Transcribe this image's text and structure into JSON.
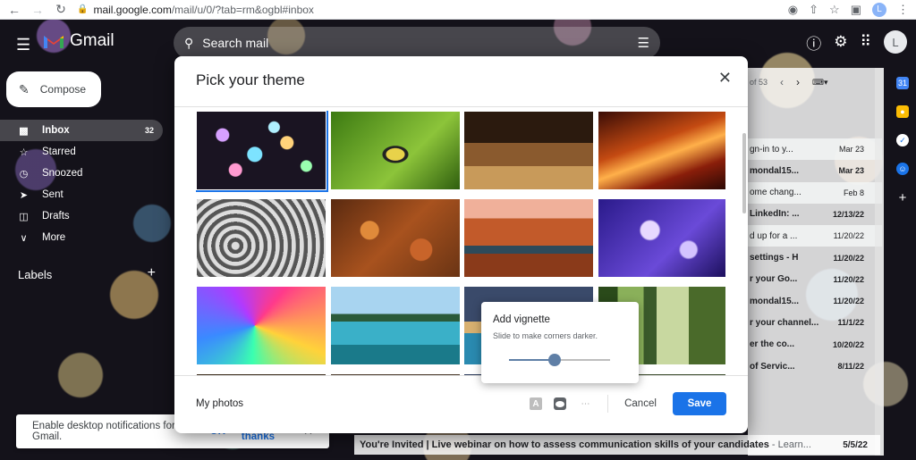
{
  "browser": {
    "url_host": "mail.google.com",
    "url_path": "/mail/u/0/?tab=rm&ogbl#inbox",
    "profile_initial": "L"
  },
  "gmail": {
    "app_name": "Gmail",
    "search_placeholder": "Search mail",
    "avatar_initial": "L",
    "compose_label": "Compose",
    "nav": [
      {
        "label": "Inbox",
        "count": "32",
        "icon": "inbox-icon",
        "active": true
      },
      {
        "label": "Starred",
        "count": "",
        "icon": "star-icon"
      },
      {
        "label": "Snoozed",
        "count": "",
        "icon": "clock-icon"
      },
      {
        "label": "Sent",
        "count": "",
        "icon": "send-icon"
      },
      {
        "label": "Drafts",
        "count": "",
        "icon": "draft-icon"
      },
      {
        "label": "More",
        "count": "",
        "icon": "chevron-down-icon"
      }
    ],
    "labels_heading": "Labels",
    "pager_text": "of 53",
    "emails": [
      {
        "snippet": "gn-in to y...",
        "date": "Mar 23",
        "unread": false
      },
      {
        "snippet": "mondal15...",
        "date": "Mar 23",
        "unread": true
      },
      {
        "snippet": "ome chang...",
        "date": "Feb 8",
        "unread": false
      },
      {
        "snippet": "LinkedIn: ...",
        "date": "12/13/22",
        "unread": true
      },
      {
        "snippet": "d up for a ...",
        "date": "11/20/22",
        "unread": false
      },
      {
        "snippet": "settings - H",
        "date": "11/20/22",
        "unread": true
      },
      {
        "snippet": "r your Go...",
        "date": "11/20/22",
        "unread": true
      },
      {
        "snippet": "mondal15...",
        "date": "11/20/22",
        "unread": true
      },
      {
        "snippet": "r your channel...",
        "date": "11/1/22",
        "unread": true
      },
      {
        "snippet": "er the co...",
        "date": "10/20/22",
        "unread": true
      },
      {
        "snippet": "of Servic...",
        "date": "8/11/22",
        "unread": true
      }
    ],
    "bottom_email": {
      "subject": "You're Invited | Live webinar on how to assess communication skills of your candidates",
      "snippet": " - Learn...",
      "date": "5/5/22"
    },
    "toast": {
      "message": "Enable desktop notifications for Gmail.",
      "ok": "OK",
      "no_thanks": "No thanks"
    }
  },
  "dialog": {
    "title": "Pick your theme",
    "my_photos": "My photos",
    "cancel": "Cancel",
    "save": "Save",
    "themes": [
      "bokeh-lights",
      "caterpillar",
      "chess",
      "canyon-red",
      "pipes",
      "autumn-leaves",
      "canyon-river",
      "jellyfish",
      "rainbow-water",
      "lake-islands",
      "beach-sky",
      "forest"
    ],
    "selected_theme_index": 0,
    "vignette": {
      "title": "Add vignette",
      "subtitle": "Slide to make corners darker.",
      "level": 0.45
    }
  }
}
